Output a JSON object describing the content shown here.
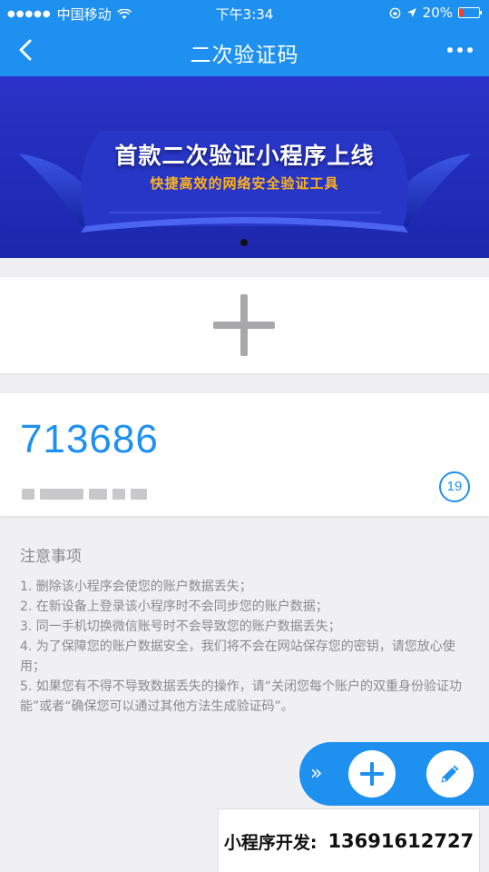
{
  "status_bar": {
    "carrier": "中国移动",
    "time": "下午3:34",
    "battery": "20%",
    "battery_level": 0.2
  },
  "nav": {
    "title": "二次验证码"
  },
  "banner": {
    "headline": "首款二次验证小程序上线",
    "subtitle": "快捷高效的网络安全验证工具",
    "page_count": 1,
    "active_page": 1
  },
  "code_entry": {
    "code": "713686",
    "countdown": "19"
  },
  "notes": {
    "heading": "注意事项",
    "items": [
      "1. 删除该小程序会使您的账户数据丢失；",
      "2. 在新设备上登录该小程序时不会同步您的账户数据；",
      "3. 同一手机切换微信账号时不会导致您的账户数据丢失；",
      "4. 为了保障您的账户数据安全，我们将不会在网站保存您的密钥，请您放心使用；",
      "5. 如果您有不得不导致数据丢失的操作，请“关闭您每个账户的双重身份验证功能”或者“确保您可以通过其他方法生成验证码”。"
    ]
  },
  "fab": {
    "collapse_label": "»"
  },
  "contact": {
    "label": "小程序开发:",
    "phone": "13691612727"
  },
  "colors": {
    "primary": "#1e90f0",
    "banner_bg": "#2230b8",
    "banner_accent": "#ffb21a",
    "note_text": "#8b8b8f"
  }
}
